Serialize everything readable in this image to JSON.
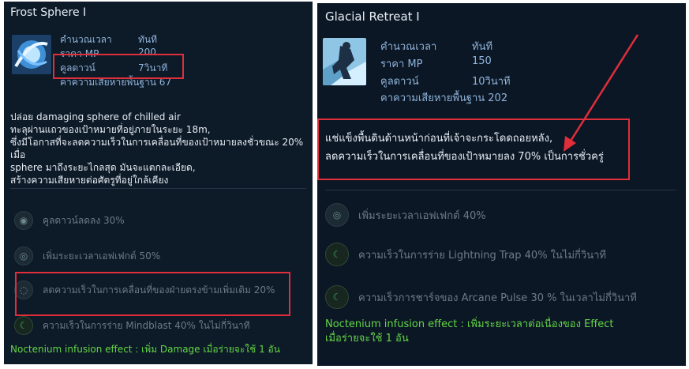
{
  "left_card": {
    "title": "Frost Sphere I",
    "stats": [
      {
        "label": "คำนวณเวลา",
        "value": "ทันที"
      },
      {
        "label": "ราคา MP",
        "value": "200"
      },
      {
        "label": "คูลดาวน์",
        "value": "7วินาที"
      },
      {
        "label": "คาความเสียหายพื้นฐาน 67",
        "value": ""
      }
    ],
    "description": [
      "ปล่อย damaging sphere of chilled air",
      "ทะลุผ่านแถวของเป้าหมายที่อยู่ภายในระยะ 18m,",
      "ซึ่งมีโอกาสที่จะลดความเร็วในการเคลื่อนที่ของเป้าหมายลงชั่วขณะ 20% เมื่อ",
      "sphere มาถึงระยะไกลสุด มันจะแตกละเอียด,",
      "สร้างความเสียหายต่อศัตรูที่อยู่ใกล้เคียง"
    ],
    "modifiers": [
      {
        "icon": "cooldown-rune-icon",
        "text": "คูลดาวน์ลดลง 30%"
      },
      {
        "icon": "duration-rune-icon",
        "text": "เพิ่มระยะเวลาเอฟเฟกต์ 50%"
      },
      {
        "icon": "slow-rune-icon",
        "text": "ลดความเร็วในการเคลื่อนที่ของฝ่ายตรงข้ามเพิ่มเติม 20%"
      },
      {
        "icon": "speed-rune-icon",
        "text": "ความเร็วในการร่าย Mindblast 40% ในไม่กี่วินาที"
      }
    ],
    "infusion": "Noctenium infusion effect : เพิ่ม Damage เมื่อร่ายจะใช้ 1 อัน"
  },
  "right_card": {
    "title": "Glacial Retreat I",
    "stats": [
      {
        "label": "คำนวณเวลา",
        "value": "ทันที"
      },
      {
        "label": "ราคา MP",
        "value": "150"
      },
      {
        "label": "คูลดาวน์",
        "value": "10วินาที"
      },
      {
        "label": "คาความเสียหายพื้นฐาน 202",
        "value": ""
      }
    ],
    "description": [
      "แช่แข็งพื้นดินด้านหน้าก่อนที่เจ้าจะกระโดดถอยหลัง,",
      "ลดความเร็วในการเคลื่อนที่ของเป้าหมายลง 70% เป็นการชั่วครู่"
    ],
    "modifiers": [
      {
        "icon": "duration-rune-icon",
        "text": "เพิ่มระยะเวลาเอฟเฟกต์ 40%"
      },
      {
        "icon": "speed-rune-icon",
        "text": "ความเร็วในการร่าย Lightning Trap 40% ในไม่กี่วินาที"
      },
      {
        "icon": "charge-rune-icon",
        "text": "ความเร็วการชาร์จของ Arcane Pulse 30 % ในเวลาไม่กี่วินาที"
      }
    ],
    "infusion": [
      "Noctenium infusion effect : เพิ่มระยะเวลาต่อเนื่องของ Effect",
      "เมื่อร่ายจะใช้ 1 อัน"
    ]
  },
  "colors": {
    "highlight": "#e02e3a",
    "infusion": "#63d644",
    "stat": "#8fb3d8"
  }
}
